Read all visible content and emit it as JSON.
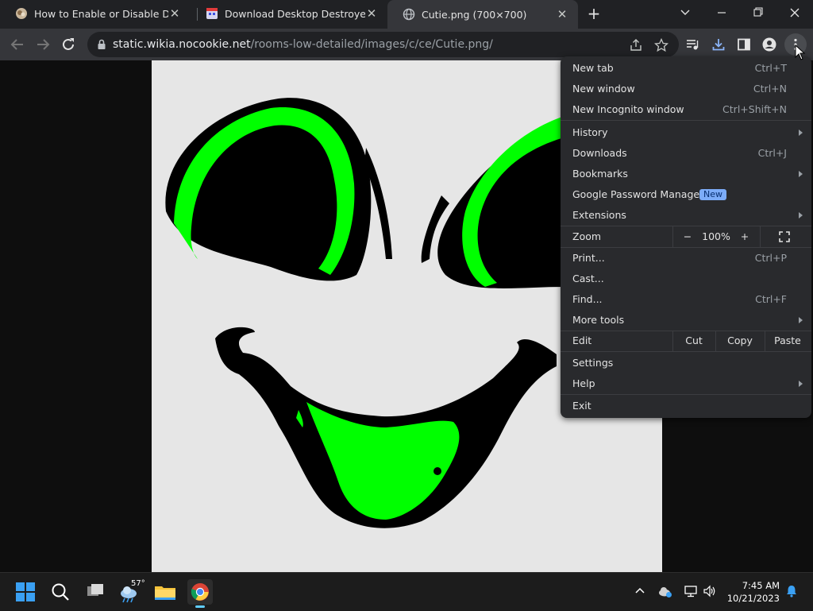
{
  "tabs": [
    {
      "title": "How to Enable or Disable Direct",
      "favicon": "tutorial-site-icon",
      "active": false
    },
    {
      "title": "Download Desktop Destroyer",
      "favicon": "calendar-app-icon",
      "active": false
    },
    {
      "title": "Cutie.png (700×700)",
      "favicon": "globe-icon",
      "active": true
    }
  ],
  "toolbar": {
    "url_host": "static.wikia.nocookie.net",
    "url_path": "/rooms-low-detailed/images/c/ce/Cutie.png/"
  },
  "menu": {
    "new_tab": {
      "label": "New tab",
      "shortcut": "Ctrl+T"
    },
    "new_window": {
      "label": "New window",
      "shortcut": "Ctrl+N"
    },
    "new_incognito": {
      "label": "New Incognito window",
      "shortcut": "Ctrl+Shift+N"
    },
    "history": {
      "label": "History"
    },
    "downloads": {
      "label": "Downloads",
      "shortcut": "Ctrl+J"
    },
    "bookmarks": {
      "label": "Bookmarks"
    },
    "password_manager": {
      "label": "Google Password Manager",
      "badge": "New"
    },
    "extensions": {
      "label": "Extensions"
    },
    "zoom": {
      "label": "Zoom",
      "minus": "−",
      "value": "100%",
      "plus": "+"
    },
    "print": {
      "label": "Print...",
      "shortcut": "Ctrl+P"
    },
    "cast": {
      "label": "Cast..."
    },
    "find": {
      "label": "Find...",
      "shortcut": "Ctrl+F"
    },
    "more_tools": {
      "label": "More tools"
    },
    "edit": {
      "label": "Edit",
      "cut": "Cut",
      "copy": "Copy",
      "paste": "Paste"
    },
    "settings": {
      "label": "Settings"
    },
    "help": {
      "label": "Help"
    },
    "exit": {
      "label": "Exit"
    }
  },
  "taskbar": {
    "weather_temp": "57°",
    "time": "7:45 AM",
    "date": "10/21/2023"
  },
  "colors": {
    "chrome_dark": "#202124",
    "toolbar": "#35363a",
    "menu_bg": "#292a2d",
    "badge": "#7cacf8",
    "image_green": "#00ff00",
    "taskbar_accent": "#60cdff"
  }
}
